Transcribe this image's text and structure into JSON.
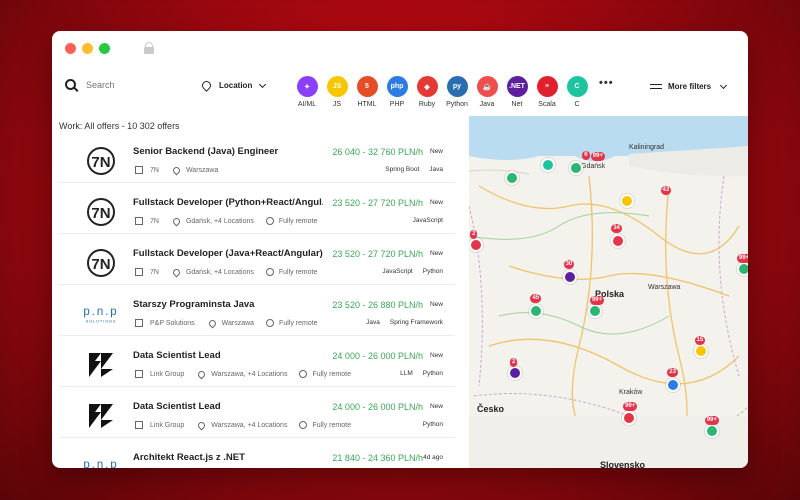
{
  "search": {
    "placeholder": "Search"
  },
  "location": {
    "label": "Location"
  },
  "techs": [
    {
      "label": "AI/ML",
      "glyph": "✦",
      "color": "#8a3ffc",
      "icon": "sparkle-icon"
    },
    {
      "label": "JS",
      "glyph": "JS",
      "color": "#f7c600",
      "icon": "js-icon"
    },
    {
      "label": "HTML",
      "glyph": "5",
      "color": "#e44d26",
      "icon": "html-icon"
    },
    {
      "label": "PHP",
      "glyph": "php",
      "color": "#2c7be5",
      "icon": "php-icon"
    },
    {
      "label": "Ruby",
      "glyph": "◆",
      "color": "#e53935",
      "icon": "ruby-icon"
    },
    {
      "label": "Python",
      "glyph": "py",
      "color": "#2a6db0",
      "icon": "python-icon"
    },
    {
      "label": "Java",
      "glyph": "☕",
      "color": "#f04e4e",
      "icon": "java-icon"
    },
    {
      "label": "Net",
      "glyph": ".NET",
      "color": "#5c1f9e",
      "icon": "dotnet-icon"
    },
    {
      "label": "Scala",
      "glyph": "≡",
      "color": "#e0202e",
      "icon": "scala-icon"
    },
    {
      "label": "C",
      "glyph": "C",
      "color": "#1ec3a0",
      "icon": "c-icon"
    }
  ],
  "more_filters": {
    "label": "More filters"
  },
  "list": {
    "title": "Work: All offers - 10 302 offers"
  },
  "offers": [
    {
      "title": "Senior Backend (Java) Engineer",
      "salary": "26 040 - 32 760 PLN/h",
      "badge": "New",
      "company": "7N",
      "location": "Warszawa",
      "remote": "",
      "tags": [
        "Spring Boot",
        "Java"
      ],
      "logo": "7N"
    },
    {
      "title": "Fullstack Developer (Python+React/Angul...",
      "salary": "23 520 - 27 720 PLN/h",
      "badge": "New",
      "company": "7N",
      "location": "Gdańsk, +4 Locations",
      "remote": "Fully remote",
      "tags": [
        "JavaScript"
      ],
      "logo": "7N"
    },
    {
      "title": "Fullstack Developer (Java+React/Angular)",
      "salary": "23 520 - 27 720 PLN/h",
      "badge": "New",
      "company": "7N",
      "location": "Gdańsk, +4 Locations",
      "remote": "Fully remote",
      "tags": [
        "JavaScript",
        "Python"
      ],
      "logo": "7N"
    },
    {
      "title": "Starszy Programinsta Java",
      "salary": "23 520 - 26 880 PLN/h",
      "badge": "New",
      "company": "P&P Solutions",
      "location": "Warszawa",
      "remote": "Fully remote",
      "tags": [
        "Java",
        "Spring Framework"
      ],
      "logo": "PNP"
    },
    {
      "title": "Data Scientist Lead",
      "salary": "24 000 - 26 000 PLN/h",
      "badge": "New",
      "company": "Link Group",
      "location": "Warszawa, +4 Locations",
      "remote": "Fully remote",
      "tags": [
        "LLM",
        "Python"
      ],
      "logo": "LINK"
    },
    {
      "title": "Data Scientist Lead",
      "salary": "24 000 - 26 000 PLN/h",
      "badge": "New",
      "company": "Link Group",
      "location": "Warszawa, +4 Locations",
      "remote": "Fully remote",
      "tags": [
        "Python"
      ],
      "logo": "LINK"
    },
    {
      "title": "Architekt React.js z .NET",
      "salary": "21 840 - 24 360 PLN/h",
      "badge": "4d ago",
      "company": "",
      "location": "",
      "remote": "",
      "tags": [],
      "logo": "PNP"
    }
  ],
  "map": {
    "cities": [
      "Kaliningrad",
      "Gdańsk",
      "Polska",
      "Warszawa",
      "Kraków",
      "Česko",
      "Slovensko"
    ],
    "counts": [
      "2",
      "6",
      "99+",
      "43",
      "34",
      "30",
      "45",
      "99+",
      "15",
      "2",
      "23",
      "99+",
      "99+",
      "99+",
      "2"
    ]
  }
}
